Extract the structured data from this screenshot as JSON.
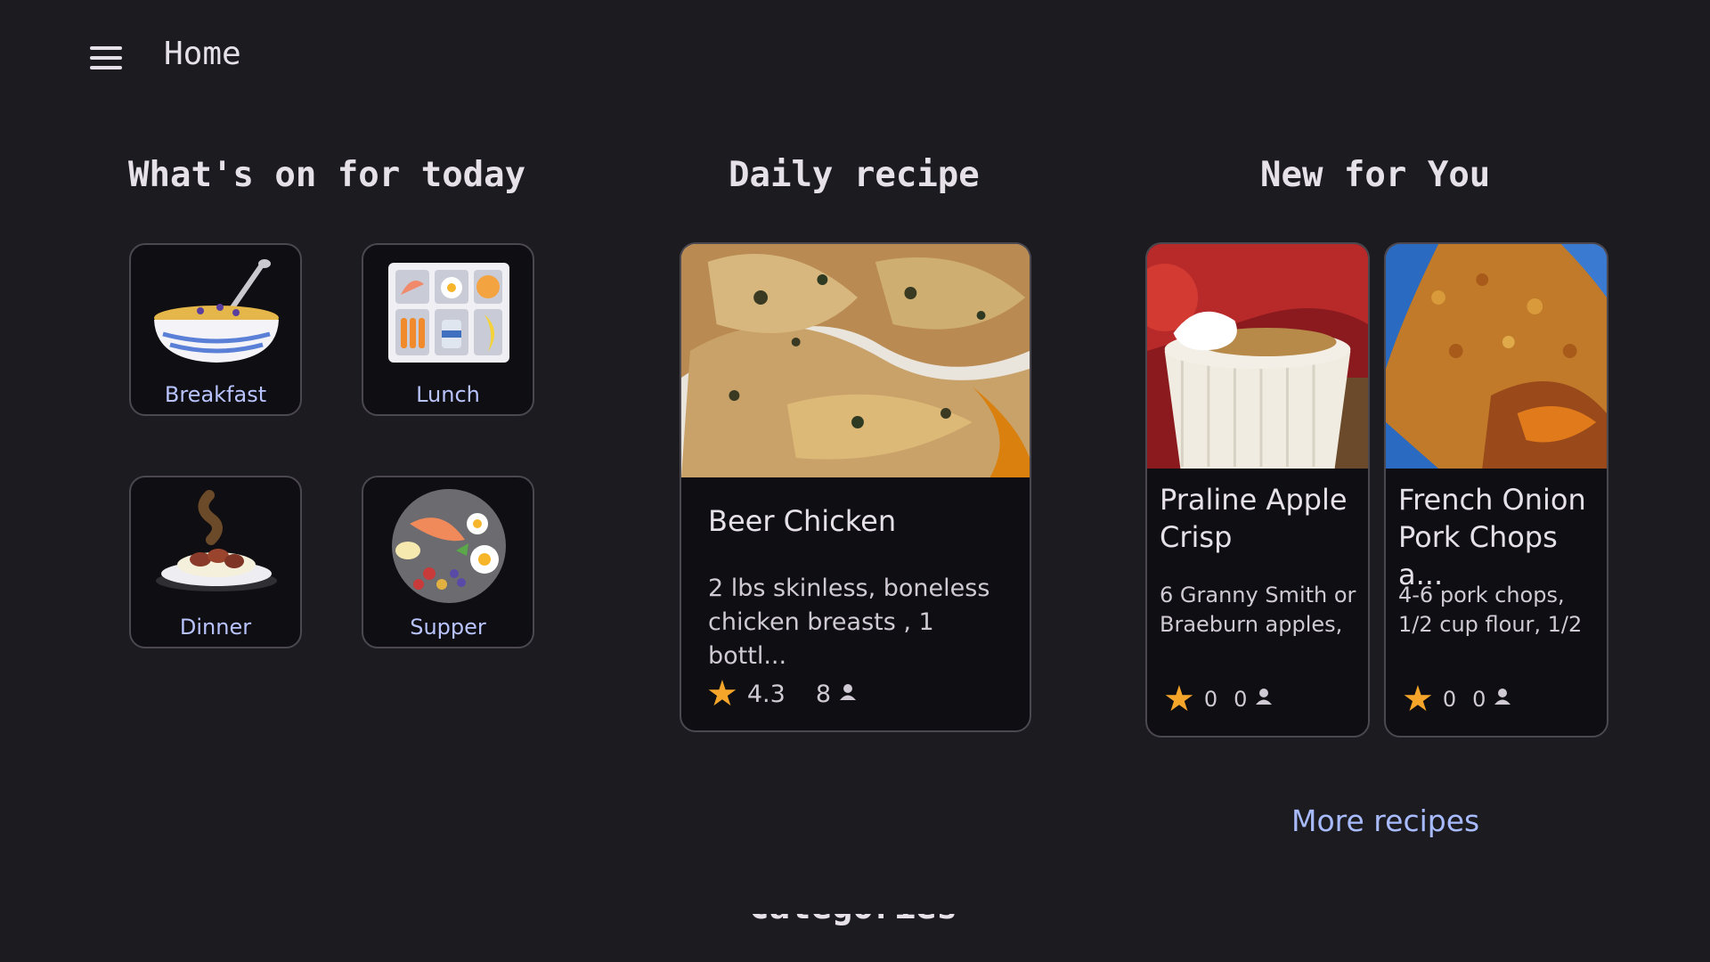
{
  "app": {
    "title": "Home"
  },
  "sections": {
    "today": "What's on for today",
    "daily": "Daily recipe",
    "new_for_you": "New for You",
    "bottom_partial": "Categories"
  },
  "meals": [
    {
      "label": "Breakfast",
      "icon": "cereal-bowl-icon"
    },
    {
      "label": "Lunch",
      "icon": "lunch-tray-icon"
    },
    {
      "label": "Dinner",
      "icon": "dinner-plate-icon"
    },
    {
      "label": "Supper",
      "icon": "supper-plate-icon"
    }
  ],
  "daily_recipe": {
    "title": "Beer Chicken",
    "description": "2 lbs skinless, boneless chicken breasts , 1 bottl...",
    "rating": "4.3",
    "reviews": "8"
  },
  "new_recipes": [
    {
      "title": "Praline Apple Crisp",
      "description": "6 Granny Smith or Braeburn apples,",
      "rating": "0",
      "reviews": "0"
    },
    {
      "title": "French Onion Pork Chops a...",
      "description": "4-6 pork chops, 1/2 cup flour, 1/2",
      "rating": "0",
      "reviews": "0"
    }
  ],
  "more_recipes": "More recipes",
  "colors": {
    "background": "#1c1b20",
    "card": "#0f0e12",
    "accent": "#b9c4ff",
    "star": "#f4a52a"
  }
}
